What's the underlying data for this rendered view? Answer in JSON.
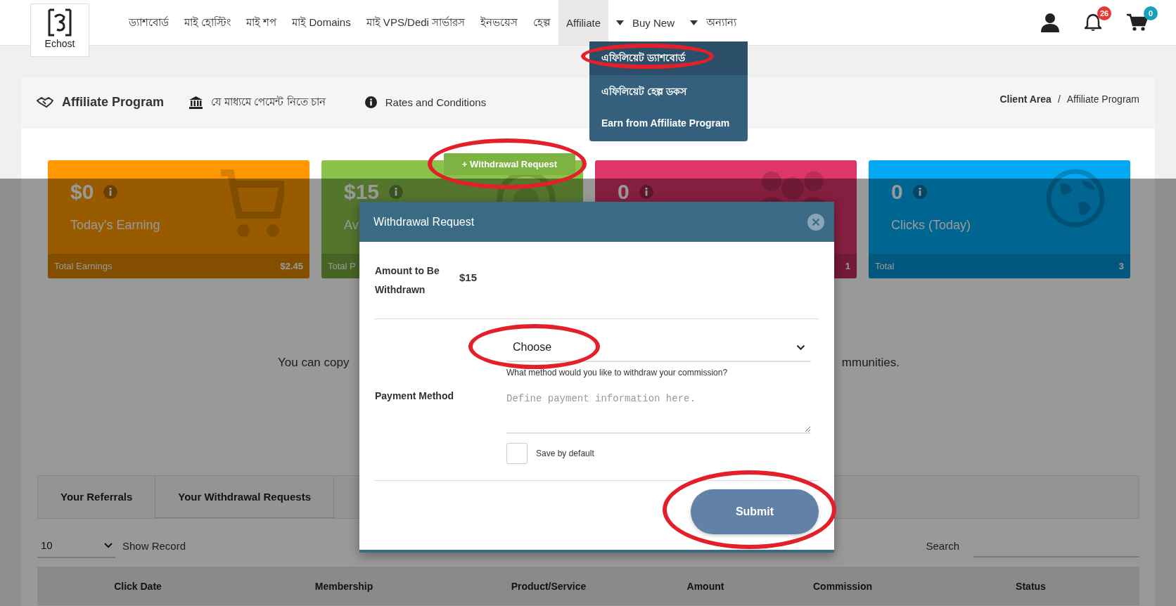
{
  "logo": {
    "name": "Echost"
  },
  "nav": {
    "items": [
      {
        "label": "ড্যাশবোর্ড",
        "selected": false,
        "caret": false
      },
      {
        "label": "মাই হোস্টিং",
        "selected": false,
        "caret": false
      },
      {
        "label": "মাই শপ",
        "selected": false,
        "caret": false
      },
      {
        "label": "মাই Domains",
        "selected": false,
        "caret": false
      },
      {
        "label": "মাই VPS/Dedi সার্ভারস",
        "selected": false,
        "caret": false
      },
      {
        "label": "ইনভয়েস",
        "selected": false,
        "caret": false
      },
      {
        "label": "হেল্প",
        "selected": false,
        "caret": false
      },
      {
        "label": "Affiliate",
        "selected": true,
        "caret": false
      },
      {
        "label": "Buy New",
        "selected": false,
        "caret": true
      },
      {
        "label": "অন্যান্য",
        "selected": false,
        "caret": true
      }
    ],
    "notifications": {
      "count": "26"
    },
    "cart": {
      "count": "0"
    }
  },
  "dropdown": {
    "items": [
      {
        "label": "এফিলিয়েট ড্যাশবোর্ড",
        "selected": true,
        "circled": true
      },
      {
        "label": "এফিলিয়েট হেল্প ডকস",
        "selected": false,
        "circled": false
      },
      {
        "label": "Earn from Affiliate Program",
        "selected": false,
        "circled": false
      }
    ]
  },
  "panel": {
    "title": "Affiliate Program",
    "links": [
      {
        "kind": "bank",
        "label": "যে মাধ্যমে পেমেন্ট নিতে চান"
      },
      {
        "kind": "info",
        "label": "Rates and Conditions"
      }
    ],
    "breadcrumb": [
      "Client Area",
      "/",
      "Affiliate Program"
    ]
  },
  "withdraw_button": {
    "label": "+ Withdrawal Request",
    "circled": true
  },
  "cards": [
    {
      "kind": "cart",
      "color": "#ff9800",
      "value": "$0",
      "label": "Today's Earning",
      "footer_label": "Total Earnings",
      "footer_value": "$2.45"
    },
    {
      "kind": "coin",
      "color": "#8bc34a",
      "value": "$15",
      "label": "Av",
      "footer_label": "Total P"
    },
    {
      "kind": "people",
      "color": "#de356a",
      "value": "0",
      "footer_value": "1"
    },
    {
      "kind": "globe",
      "color": "#03a9f4",
      "value": "0",
      "label": "Clicks (Today)",
      "footer_label": "Total",
      "footer_value": "3"
    }
  ],
  "intro": {
    "text_start": "You can copy",
    "text_end": "mmunities."
  },
  "tabs": [
    {
      "label": "Your Referrals",
      "selected": true
    },
    {
      "label": "Your Withdrawal Requests",
      "selected": false
    }
  ],
  "records": {
    "value": "10",
    "label": "Show Record"
  },
  "search": {
    "label": "Search"
  },
  "table": {
    "columns": [
      "Click Date",
      "Membership",
      "Product/Service",
      "Amount",
      "Commission",
      "Status"
    ]
  },
  "modal": {
    "title": "Withdrawal Request",
    "amount_label": "Amount to Be Withdrawn",
    "amount": "$15",
    "method_label": "Payment Method",
    "select": {
      "value": "Choose",
      "circled": true
    },
    "hint": "What method would you like to withdraw your commission?",
    "textarea": {
      "placeholder": "Define payment information here."
    },
    "save_default": {
      "label": "Save by default",
      "checked": false
    },
    "submit": {
      "label": "Submit",
      "circled": true
    }
  }
}
